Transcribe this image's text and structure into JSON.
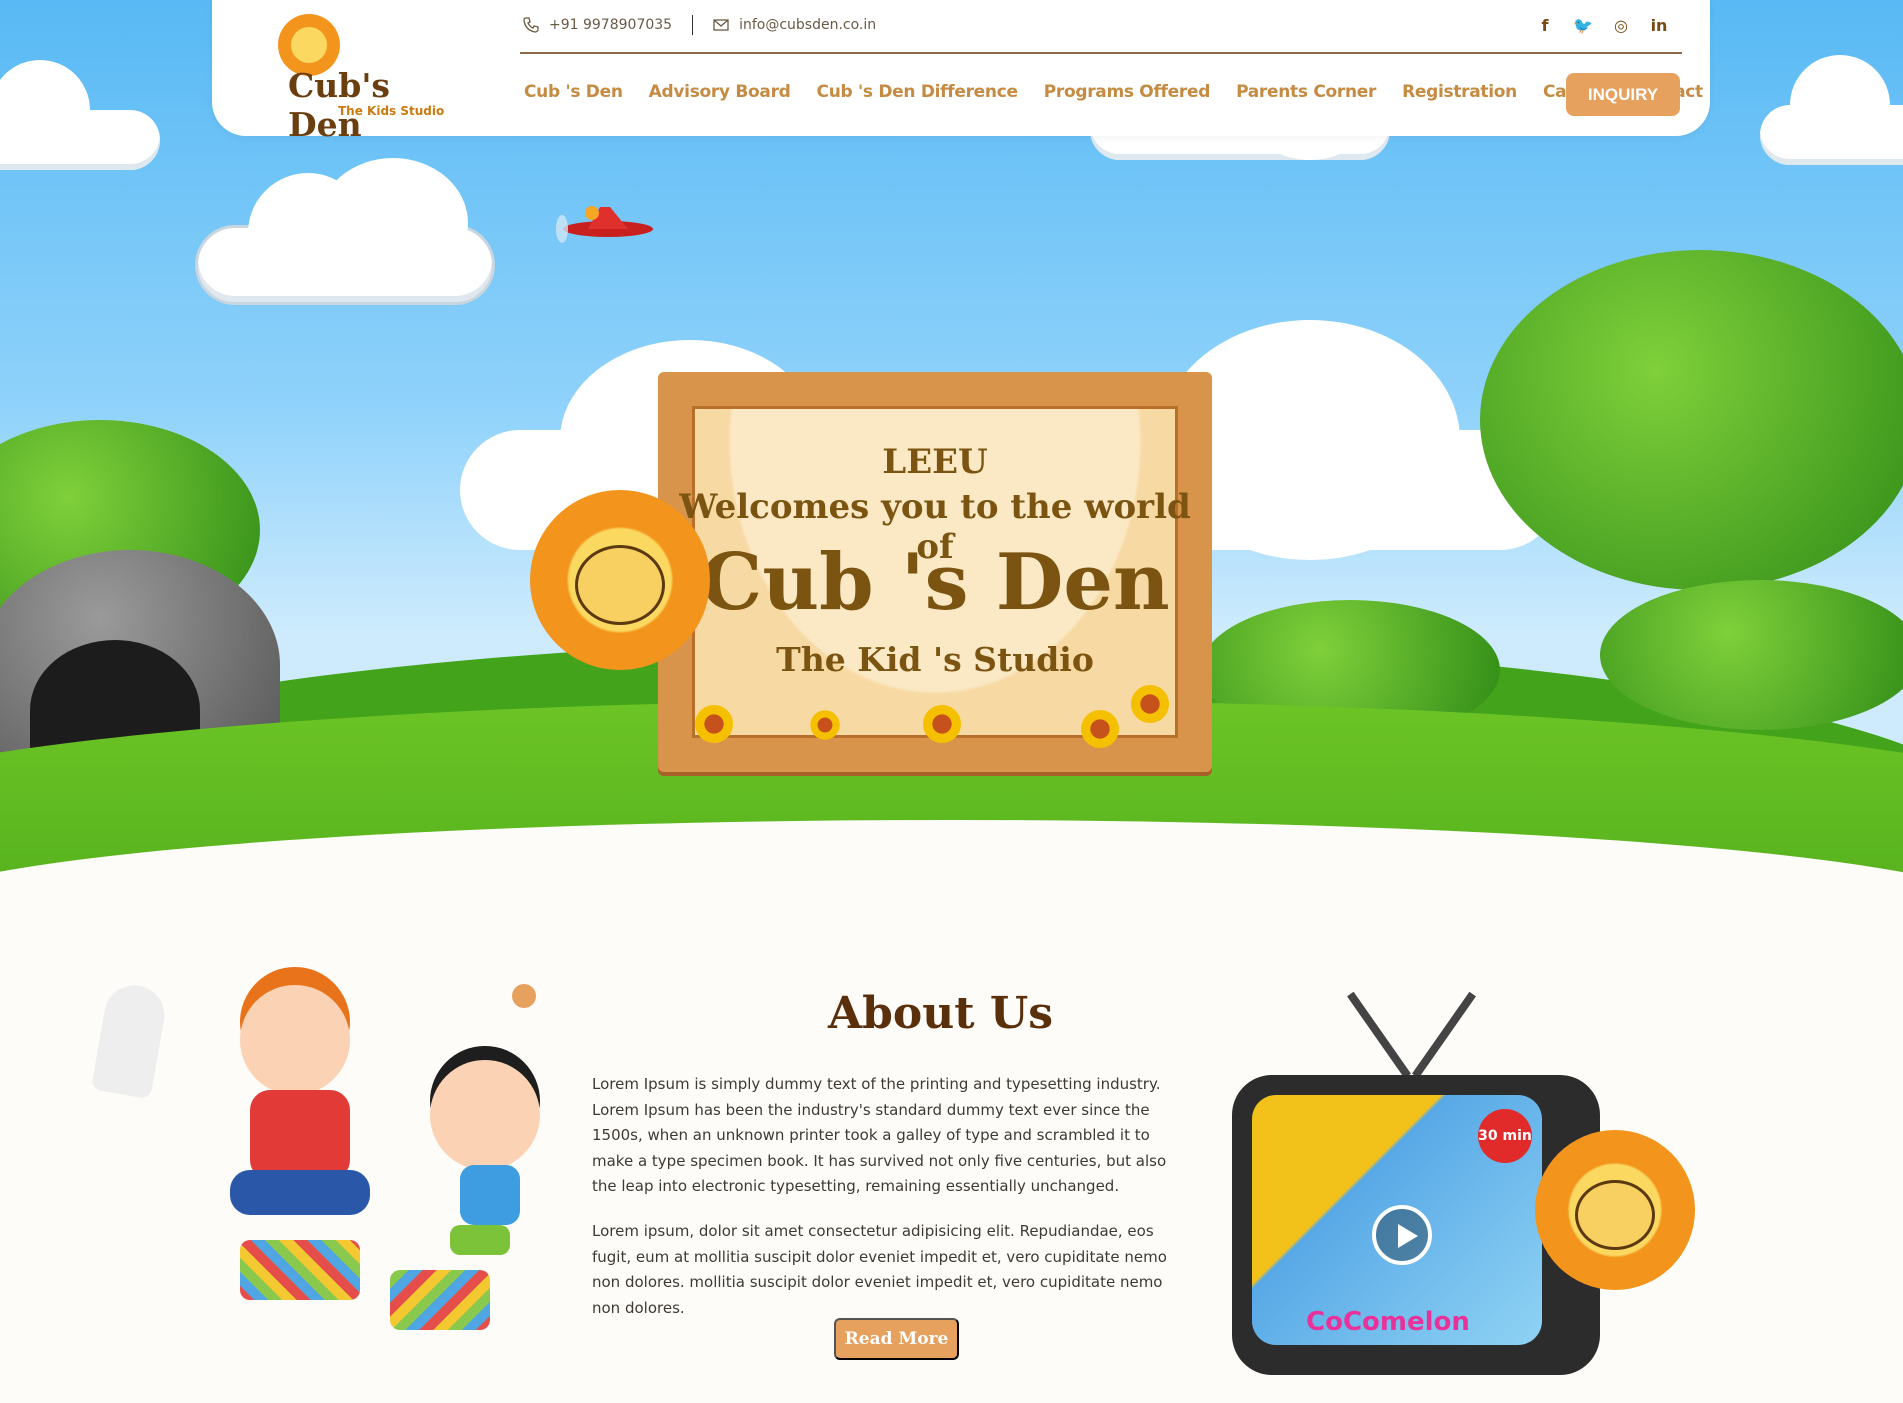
{
  "header": {
    "logo": {
      "name": "Cub's Den",
      "tagline": "The Kids Studio"
    },
    "phone": "+91 9978907035",
    "email": "info@cubsden.co.in",
    "social": [
      {
        "icon": "facebook-icon",
        "glyph": "f"
      },
      {
        "icon": "twitter-icon",
        "glyph": "🐦"
      },
      {
        "icon": "instagram-icon",
        "glyph": "◎"
      },
      {
        "icon": "linkedin-icon",
        "glyph": "in"
      }
    ],
    "nav": [
      "Cub 's Den",
      "Advisory Board",
      "Cub 's Den Difference",
      "Programs Offered",
      "Parents Corner",
      "Registration",
      "Career",
      "Contact"
    ],
    "inquiry_label": "INQUIRY"
  },
  "hero": {
    "sign_line1": "LEEU",
    "sign_line2": "Welcomes you to the world of",
    "sign_brand": "Cub 's Den",
    "sign_sub": "The Kid 's Studio"
  },
  "about": {
    "title": "About Us",
    "para1": "Lorem Ipsum is simply dummy text of the printing and typesetting industry. Lorem Ipsum has been the industry's standard dummy text ever since the 1500s, when an unknown printer took a galley of type and scrambled it to make a type specimen book. It has survived not only five centuries, but also the leap into electronic typesetting, remaining essentially unchanged.",
    "para2": "Lorem ipsum, dolor sit amet consectetur adipisicing elit. Repudiandae, eos fugit, eum at mollitia suscipit dolor eveniet impedit et, vero cupiditate nemo non dolores. mollitia suscipit dolor eveniet impedit et, vero cupiditate nemo non dolores.",
    "read_more": "Read More",
    "video_badge": "30 min",
    "video_brand": "CoComelon"
  },
  "colors": {
    "accent": "#e6a15f",
    "nav": "#c58b42",
    "brown": "#5a2f0c"
  }
}
